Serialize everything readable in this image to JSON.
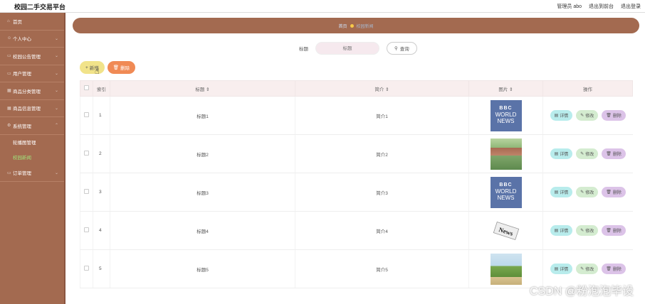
{
  "app": {
    "title": "校园二手交易平台"
  },
  "topbar": {
    "user": "管理员 abo",
    "frontend_link": "退出到前台",
    "logout_link": "退出登录"
  },
  "sidebar": {
    "items": [
      {
        "label": "首页",
        "icon": "home-icon"
      },
      {
        "label": "个人中心",
        "icon": "user-icon"
      },
      {
        "label": "校园公告管理",
        "icon": "notice-icon"
      },
      {
        "label": "用户管理",
        "icon": "users-icon"
      },
      {
        "label": "商品分类管理",
        "icon": "category-icon"
      },
      {
        "label": "商品信息管理",
        "icon": "goods-icon"
      },
      {
        "label": "系统管理",
        "icon": "settings-icon"
      }
    ],
    "sub_items": [
      {
        "label": "轮播图管理"
      },
      {
        "label": "校园新闻"
      }
    ],
    "after_items": [
      {
        "label": "订单管理",
        "icon": "order-icon"
      }
    ]
  },
  "breadcrumb": {
    "home": "首页",
    "current": "校园新闻"
  },
  "search": {
    "label": "标题",
    "placeholder": "标题",
    "button": "查询"
  },
  "toolbar": {
    "add": "新增",
    "delete": "删除"
  },
  "table": {
    "headers": {
      "index": "索引",
      "title": "标题",
      "intro": "简介",
      "image": "图片",
      "ops": "操作"
    },
    "rows": [
      {
        "index": "1",
        "title": "标题1",
        "intro": "简介1",
        "image": "bbc"
      },
      {
        "index": "2",
        "title": "标题2",
        "intro": "简介2",
        "image": "building"
      },
      {
        "index": "3",
        "title": "标题3",
        "intro": "简介3",
        "image": "bbc"
      },
      {
        "index": "4",
        "title": "标题4",
        "intro": "简介4",
        "image": "news"
      },
      {
        "index": "5",
        "title": "标题5",
        "intro": "简介5",
        "image": "park"
      }
    ],
    "ops": {
      "detail": "详情",
      "edit": "修改",
      "delete": "删除"
    },
    "bbc_text": {
      "logo": "BBC",
      "line1": "WORLD",
      "line2": "NEWS"
    },
    "news_text": "News"
  },
  "watermark": "CSDN @粉泡泡毕设",
  "colors": {
    "sidebar": "#a36a50",
    "add": "#f1e38a",
    "delete": "#f08a55",
    "detail": "#b8ecec",
    "edit": "#d4ecd0",
    "op_delete": "#dcc3e8"
  }
}
